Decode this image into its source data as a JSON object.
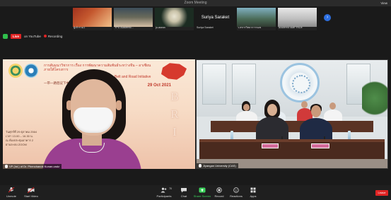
{
  "window": {
    "title": "Zoom Meeting",
    "view_label": "View"
  },
  "status": {
    "live_badge": "Live",
    "live_target": "on YouTube",
    "recording_label": "Recording"
  },
  "gallery_strip": {
    "thumbnails": [
      {
        "name": "ผู้เข้าร่วม1",
        "colors": [
          "#a0321e",
          "#f2c28a"
        ]
      },
      {
        "name": "YPU Academic...",
        "colors": [
          "#3c4d5a",
          "#d6c0a6"
        ]
      },
      {
        "name": "ju-asean",
        "colors": [
          "#1c2c22",
          "#c9c2a8"
        ]
      },
      {
        "name": "Suriya Saraket",
        "colors": [
          "#1a1a1a",
          "#1a1a1a"
        ],
        "text_only": "Suriya Saraket"
      },
      {
        "name": "ว.สชารวิทยาการขอข",
        "colors": [
          "#4a6a56",
          "#7fb0c0"
        ]
      },
      {
        "name": "academic staff YNUe",
        "colors": [
          "#8a8a8a",
          "#e7e7e7"
        ]
      }
    ],
    "next_arrow": "›"
  },
  "left_video": {
    "thai_title_line1": "การสัมมนาวิชาการ เรื่อง การพัฒนาความสัมพันธ์ระหว่างจีน – อาเซียน",
    "thai_title_line2": "ภายใต้โครงการ",
    "belt_road": "Belt and Road Initiative",
    "chinese_line": "一带一路倡议下中国-东盟关系...",
    "date": "29 Oct 2021",
    "bri": [
      "B",
      "R",
      "I"
    ],
    "info_line1": "วันศุกร์ที่ 29 ตุลาคม 2564",
    "info_line2": "เวลา 13.00 – 16.30 น.",
    "info_line3": "ณ ห้องประชุมอาคาร 2",
    "info_line4": "ผ่านระบบ ZOOM",
    "name_tag": "VP (Int.) of Dr. Phenchanok Kunan-vadz"
  },
  "right_video": {
    "name_tag": "Jiyangan University (CAS)"
  },
  "toolbar": {
    "items": [
      {
        "label": "Unmute",
        "icon": "mic-muted-icon"
      },
      {
        "label": "Start Video",
        "icon": "video-off-icon"
      },
      {
        "label": "Participants",
        "icon": "participants-icon",
        "count": "70"
      },
      {
        "label": "Chat",
        "icon": "chat-icon"
      },
      {
        "label": "Share Screen",
        "icon": "share-screen-icon"
      },
      {
        "label": "Record",
        "icon": "record-icon"
      },
      {
        "label": "Reactions",
        "icon": "reactions-icon"
      },
      {
        "label": "Apps",
        "icon": "apps-icon"
      }
    ],
    "leave_label": "Leave"
  },
  "colors": {
    "live_red": "#e02424",
    "share_green": "#3cd35c",
    "accent_blue": "#2d6fe0"
  }
}
